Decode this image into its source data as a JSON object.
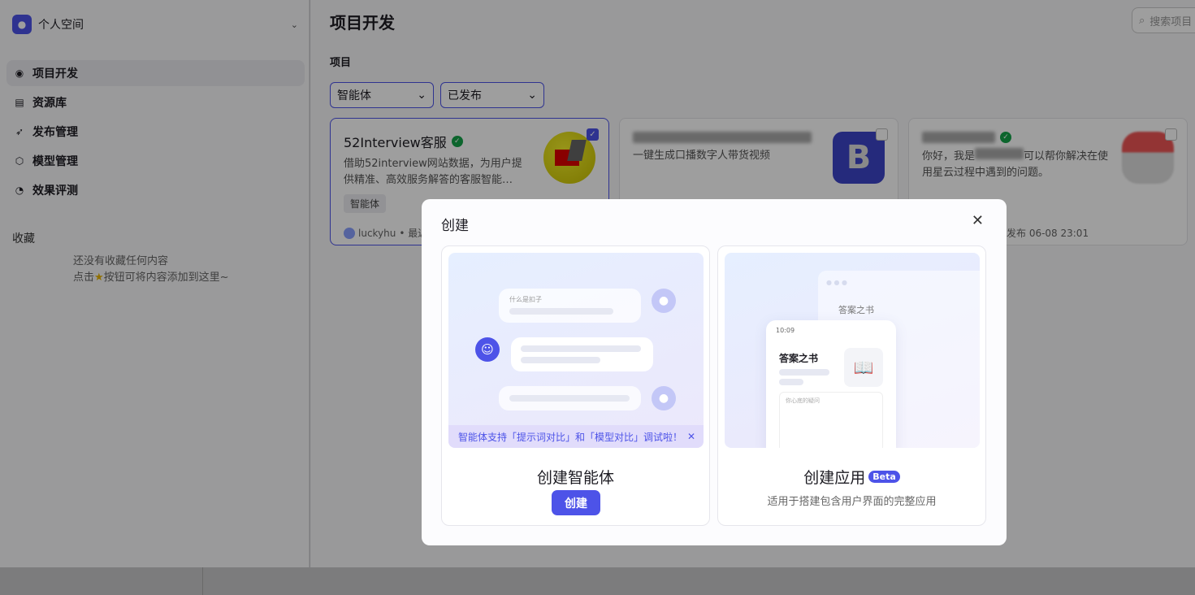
{
  "sidebar": {
    "workspace": "个人空间",
    "nav": [
      {
        "label": "项目开发",
        "icon": "bot-icon",
        "active": true
      },
      {
        "label": "资源库",
        "icon": "library-icon"
      },
      {
        "label": "发布管理",
        "icon": "rocket-icon"
      },
      {
        "label": "模型管理",
        "icon": "model-icon"
      },
      {
        "label": "效果评测",
        "icon": "gauge-icon"
      }
    ],
    "favorites_title": "收藏",
    "fav_empty_1": "还没有收藏任何内容",
    "fav_empty_2a": "点击",
    "fav_empty_2b": "按钮可将内容添加到这里~"
  },
  "main": {
    "title": "项目开发",
    "search_placeholder": "搜索项目",
    "section": "项目",
    "filters": [
      "智能体",
      "已发布"
    ],
    "cards": [
      {
        "title": "52Interview客服",
        "desc": "借助52interview网站数据，为用户提供精准、高效服务解答的客服智能…",
        "tag": "智能体",
        "author": "luckyhu",
        "meta": "• 最近",
        "checked": true
      },
      {
        "desc": "一键生成口播数字人带货视频",
        "checked": false
      },
      {
        "desc_a": "你好，我是",
        "desc_b": "可以帮你解决在使用星云过程中遇到的问题。",
        "meta": "发布 06-08 23:01",
        "checked": false
      }
    ]
  },
  "modal": {
    "title": "创建",
    "agent": {
      "q": "什么是扣子",
      "tip": "智能体支持「提示词对比」和「模型对比」调试啦！",
      "name": "创建智能体",
      "button": "创建"
    },
    "app": {
      "time": "10:09",
      "app_title": "答案之书",
      "input_ph": "你心底的疑问",
      "name": "创建应用",
      "badge": "Beta",
      "desc": "适用于搭建包含用户界面的完整应用"
    }
  },
  "colors": {
    "accent": "#4d53e8",
    "verified": "#14a34a"
  }
}
